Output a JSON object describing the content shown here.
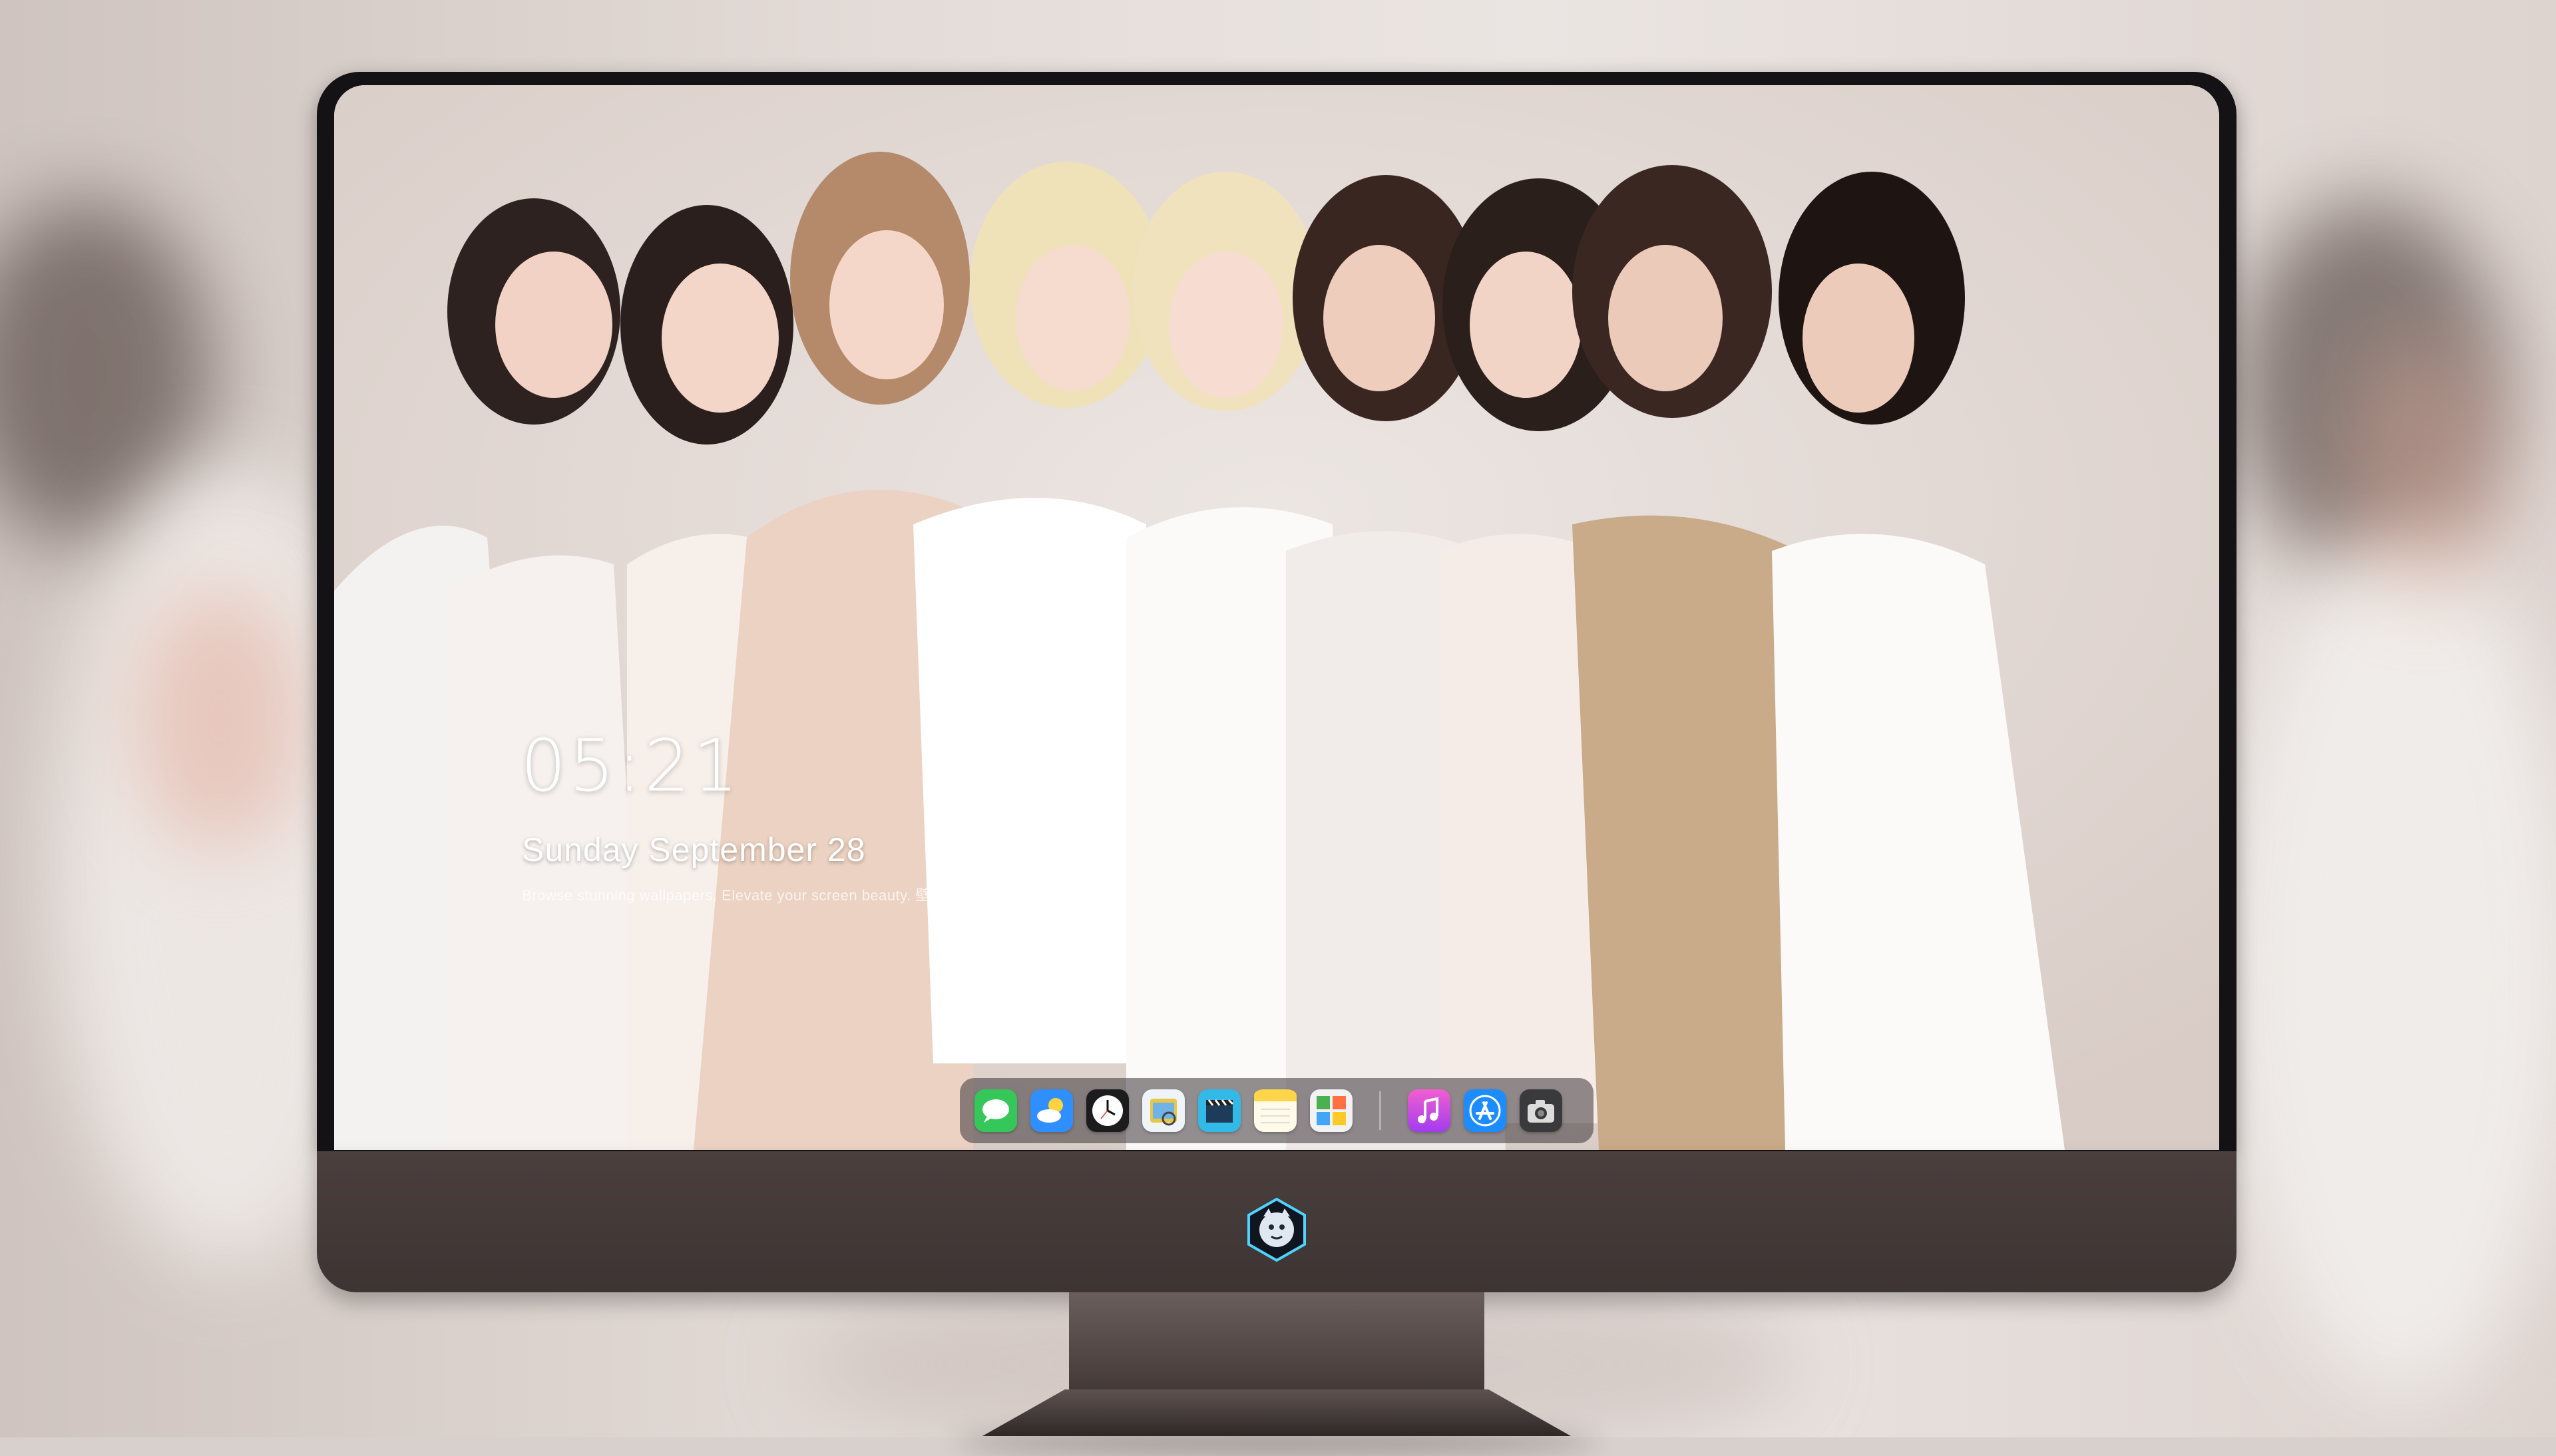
{
  "desktop": {
    "clock": {
      "time": "05:21",
      "date": "Sunday September  28"
    },
    "tagline": "Browse stunning wallpapers. Elevate your screen beauty. 壁纸迷 · Bizhimi CN"
  },
  "dock": {
    "apps": [
      {
        "name": "Messages",
        "icon": "messages-icon",
        "color": "#34c759"
      },
      {
        "name": "Weather",
        "icon": "weather-icon",
        "color": "#2f8fff"
      },
      {
        "name": "Clock",
        "icon": "clock-icon",
        "color": "#1c1c1e"
      },
      {
        "name": "Preview",
        "icon": "preview-icon",
        "color": "#e8c64a"
      },
      {
        "name": "Final Cut",
        "icon": "clapperboard-icon",
        "color": "#32b9e8"
      },
      {
        "name": "Notes",
        "icon": "notes-icon",
        "color": "#ffd54a"
      },
      {
        "name": "Photo Booth",
        "icon": "photo-grid-icon",
        "color": "#f2f2f2"
      },
      {
        "name": "iTunes",
        "icon": "music-note-icon",
        "color": "#e040c8"
      },
      {
        "name": "App Store",
        "icon": "app-store-icon",
        "color": "#1c8cff"
      },
      {
        "name": "Camera",
        "icon": "camera-icon",
        "color": "#2c2c2e"
      }
    ]
  },
  "colors": {
    "wallpaper_bg": "#e7e0dc",
    "bezel": "#141214",
    "chin": "#443a38",
    "dock_bg": "rgba(60,52,58,0.55)"
  }
}
